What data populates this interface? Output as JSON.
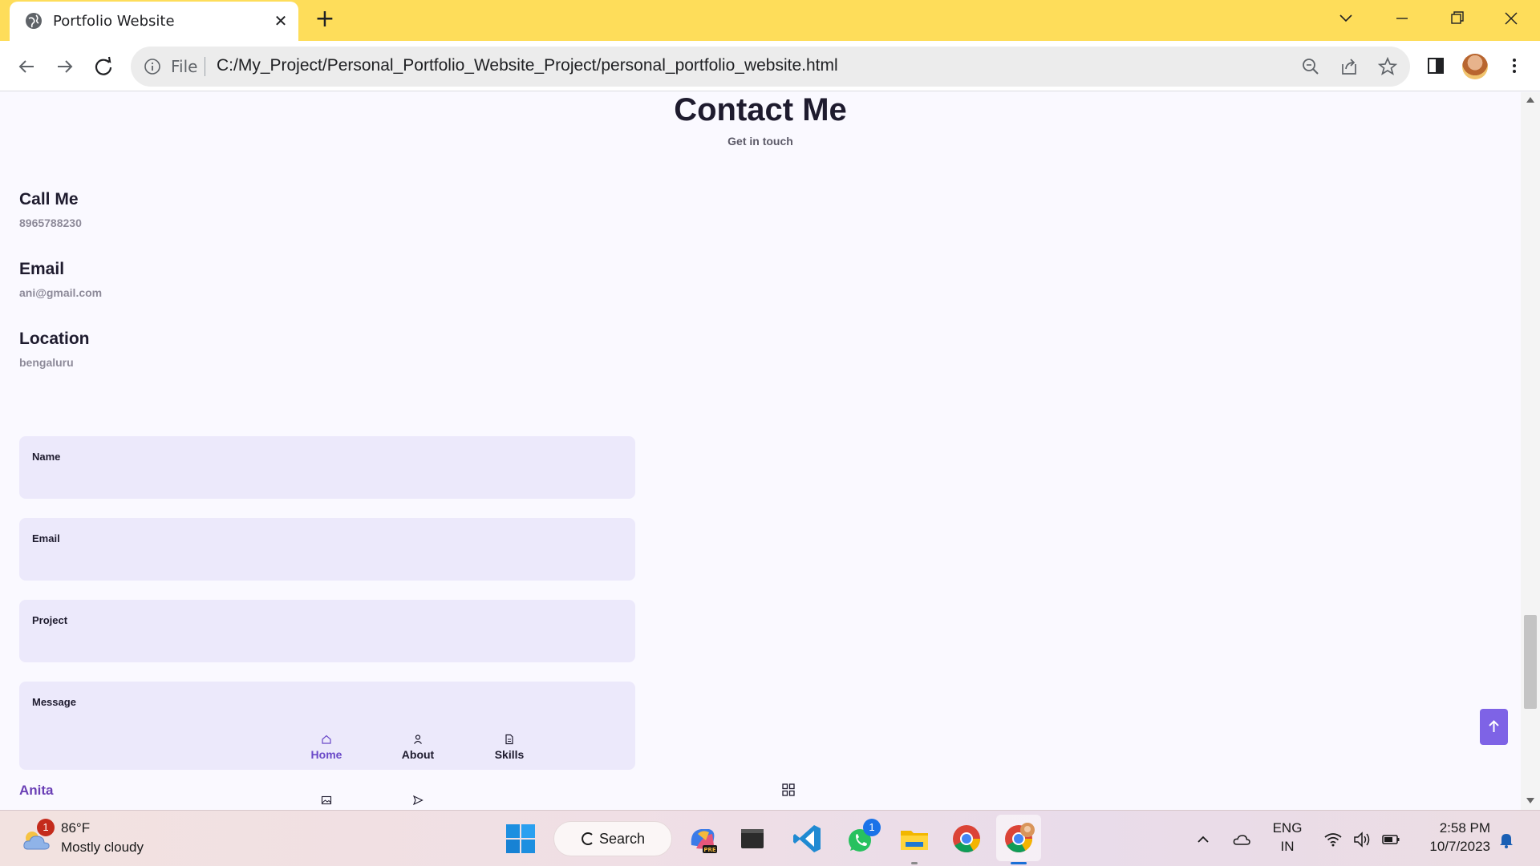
{
  "browser": {
    "tab_title": "Portfolio Website",
    "omnibox_scheme": "File",
    "url": "C:/My_Project/Personal_Portfolio_Website_Project/personal_portfolio_website.html"
  },
  "contact": {
    "title": "Contact Me",
    "subtitle": "Get in touch",
    "info": [
      {
        "title": "Call Me",
        "value": "8965788230"
      },
      {
        "title": "Email",
        "value": "ani@gmail.com"
      },
      {
        "title": "Location",
        "value": "bengaluru"
      }
    ],
    "form": {
      "name_label": "Name",
      "email_label": "Email",
      "project_label": "Project",
      "message_label": "Message"
    }
  },
  "footer": {
    "brand": "Anita"
  },
  "nav_menu": {
    "items": [
      {
        "label": "Home",
        "icon": "home-icon",
        "active": true
      },
      {
        "label": "About",
        "icon": "user-icon",
        "active": false
      },
      {
        "label": "Skills",
        "icon": "file-icon",
        "active": false
      }
    ]
  },
  "taskbar": {
    "weather": {
      "temp": "86°F",
      "desc": "Mostly cloudy",
      "badge": "1"
    },
    "search_label": "Search",
    "whatsapp_badge": "1",
    "language": "ENG",
    "region": "IN",
    "time": "2:58 PM",
    "date": "10/7/2023"
  },
  "colors": {
    "accent": "#6a49c8",
    "tab_strip": "#fedd5a",
    "input_bg": "#ece9fb"
  }
}
